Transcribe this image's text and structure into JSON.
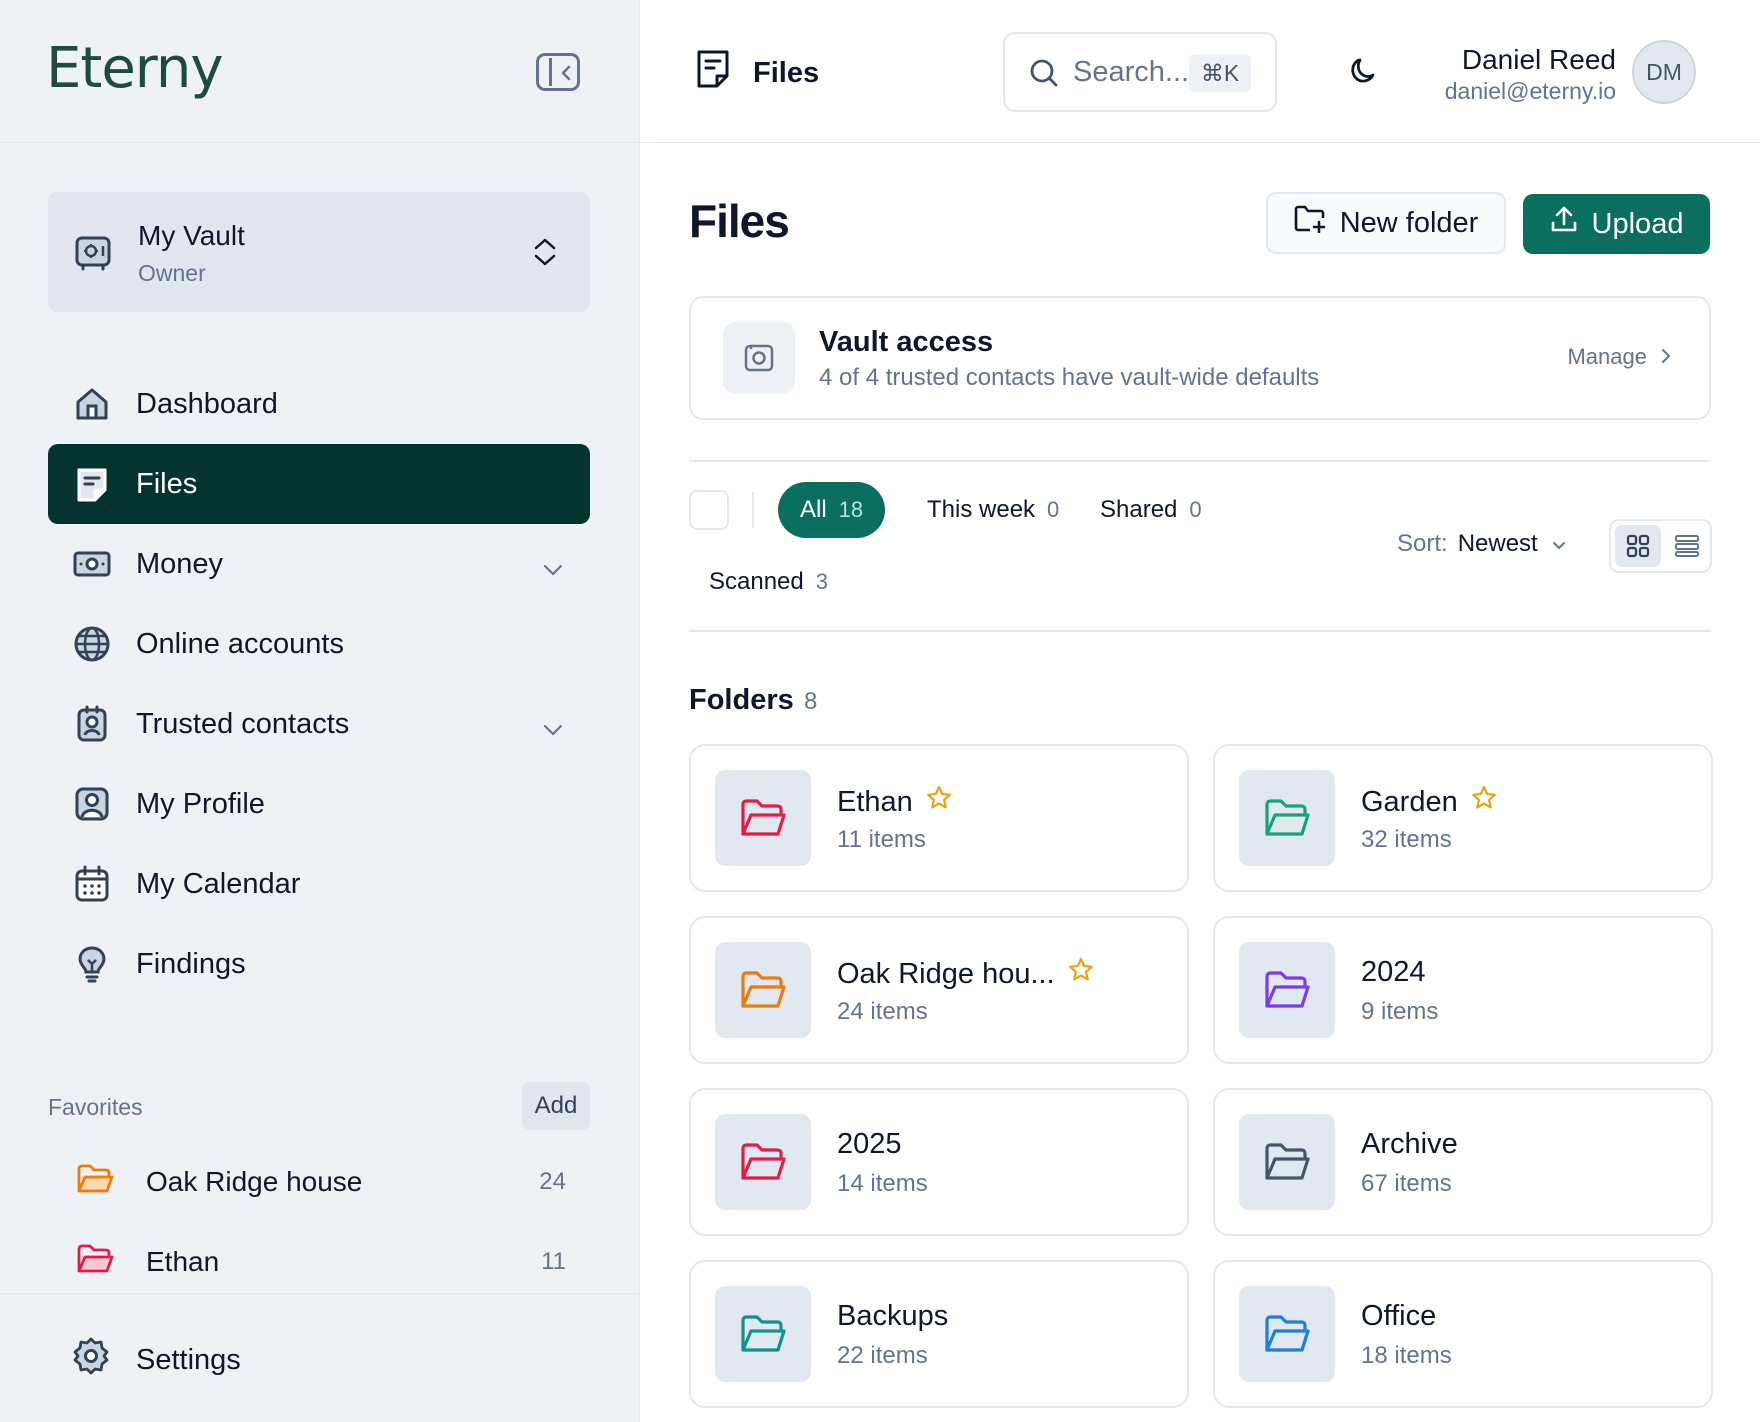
{
  "app": {
    "logo": "Eterny"
  },
  "vault": {
    "name": "My Vault",
    "role": "Owner"
  },
  "nav": [
    {
      "label": "Dashboard",
      "icon": "home-icon"
    },
    {
      "label": "Files",
      "icon": "file-icon",
      "active": true
    },
    {
      "label": "Money",
      "icon": "banknote-icon",
      "expandable": true
    },
    {
      "label": "Online accounts",
      "icon": "globe-icon"
    },
    {
      "label": "Trusted contacts",
      "icon": "contact-icon",
      "expandable": true
    },
    {
      "label": "My Profile",
      "icon": "user-icon"
    },
    {
      "label": "My Calendar",
      "icon": "calendar-icon"
    },
    {
      "label": "Findings",
      "icon": "lightbulb-icon"
    }
  ],
  "favorites": {
    "title": "Favorites",
    "add_label": "Add",
    "items": [
      {
        "label": "Oak Ridge house",
        "count": "24",
        "color": "#ea7c0b"
      },
      {
        "label": "Ethan",
        "count": "11",
        "color": "#e11d48"
      }
    ]
  },
  "settings": {
    "label": "Settings"
  },
  "header": {
    "title": "Files",
    "search_placeholder": "Search...",
    "search_shortcut": "⌘K",
    "user_name": "Daniel Reed",
    "user_email": "daniel@eterny.io",
    "avatar_initials": "DM"
  },
  "page": {
    "title": "Files",
    "new_folder_label": "New folder",
    "upload_label": "Upload"
  },
  "vault_access": {
    "title": "Vault access",
    "subtitle": "4 of 4 trusted contacts have vault-wide defaults",
    "manage_label": "Manage"
  },
  "filters": [
    {
      "label": "All",
      "count": "18",
      "active": true
    },
    {
      "label": "This week",
      "count": "0"
    },
    {
      "label": "Shared",
      "count": "0"
    },
    {
      "label": "Scanned",
      "count": "3"
    }
  ],
  "sort": {
    "prefix": "Sort:",
    "value": "Newest"
  },
  "folders_section": {
    "title": "Folders",
    "count": "8"
  },
  "folders": [
    {
      "name": "Ethan",
      "items": "11 items",
      "color": "#e11d48",
      "starred": true
    },
    {
      "name": "Garden",
      "items": "32 items",
      "color": "#16a37a",
      "starred": true
    },
    {
      "name": "Oak Ridge hou...",
      "items": "24 items",
      "color": "#ea7c0b",
      "starred": true
    },
    {
      "name": "2024",
      "items": "9 items",
      "color": "#7c3aed",
      "starred": false
    },
    {
      "name": "2025",
      "items": "14 items",
      "color": "#e11d48",
      "starred": false
    },
    {
      "name": "Archive",
      "items": "67 items",
      "color": "#475569",
      "starred": false
    },
    {
      "name": "Backups",
      "items": "22 items",
      "color": "#0d9488",
      "starred": false
    },
    {
      "name": "Office",
      "items": "18 items",
      "color": "#1d7fd6",
      "starred": false
    }
  ],
  "colors": {
    "accent": "#0a6f5e",
    "active_nav": "#05332f",
    "star": "#e8a317"
  }
}
